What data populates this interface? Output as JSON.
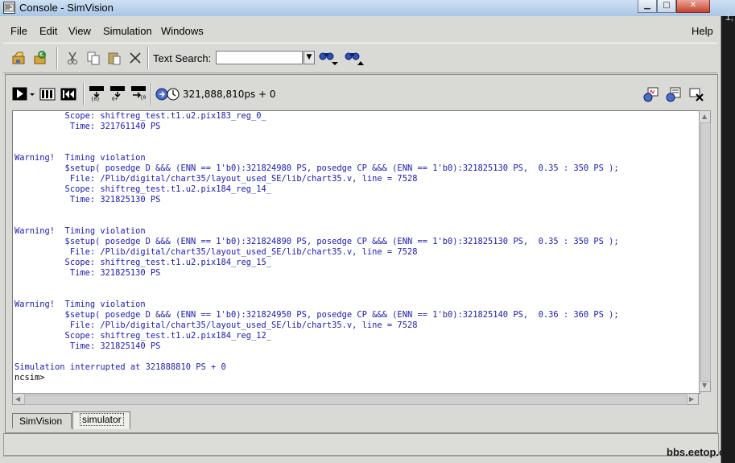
{
  "window": {
    "title": "Console - SimVision",
    "min_glyph": "▁",
    "max_glyph": "□",
    "close_glyph": "✕"
  },
  "desktop": {
    "edge_text": "1,"
  },
  "menubar": {
    "file": "File",
    "edit": "Edit",
    "view": "View",
    "simulation": "Simulation",
    "windows": "Windows",
    "help": "Help"
  },
  "toolbar": {
    "text_search_label": "Text Search:",
    "text_search_value": ""
  },
  "sim_toolbar": {
    "time": "321,888,810ps + 0"
  },
  "console": {
    "lines": [
      "          Scope: shiftreg_test.t1.u2.pix183_reg_0_",
      "           Time: 321761140 PS",
      "",
      "",
      "Warning!  Timing violation",
      "          $setup( posedge D &&& (ENN == 1'b0):321824980 PS, posedge CP &&& (ENN == 1'b0):321825130 PS,  0.35 : 350 PS );",
      "           File: /Plib/digital/chart35/layout_used_SE/lib/chart35.v, line = 7528",
      "          Scope: shiftreg_test.t1.u2.pix184_reg_14_",
      "           Time: 321825130 PS",
      "",
      "",
      "Warning!  Timing violation",
      "          $setup( posedge D &&& (ENN == 1'b0):321824890 PS, posedge CP &&& (ENN == 1'b0):321825130 PS,  0.35 : 350 PS );",
      "           File: /Plib/digital/chart35/layout_used_SE/lib/chart35.v, line = 7528",
      "          Scope: shiftreg_test.t1.u2.pix184_reg_15_",
      "           Time: 321825130 PS",
      "",
      "",
      "Warning!  Timing violation",
      "          $setup( posedge D &&& (ENN == 1'b0):321824950 PS, posedge CP &&& (ENN == 1'b0):321825140 PS,  0.36 : 360 PS );",
      "           File: /Plib/digital/chart35/layout_used_SE/lib/chart35.v, line = 7528",
      "          Scope: shiftreg_test.t1.u2.pix184_reg_12_",
      "           Time: 321825140 PS",
      "",
      "Simulation interrupted at 321888810 PS + 0"
    ],
    "prompt": "ncsim>"
  },
  "tabs": [
    {
      "label": "SimVision"
    },
    {
      "label": "simulator"
    }
  ],
  "watermark": "bbs.eetop.cn",
  "colors": {
    "console_text": "#1a1ab4",
    "titlebar": "#bcd3ec",
    "frame": "#d9d9d6"
  },
  "icons": [
    "console-window-icon",
    "open-file-icon",
    "reload-icon",
    "cut-icon",
    "copy-icon",
    "paste-icon",
    "delete-icon",
    "dropdown-arrow-icon",
    "search-up-icon",
    "search-down-icon",
    "run-icon",
    "step-icon",
    "rewind-icon",
    "step-in-icon",
    "step-out-icon",
    "step-over-icon",
    "time-clock-icon",
    "send-to-waveform-icon",
    "send-to-source-icon",
    "close-pane-icon"
  ]
}
